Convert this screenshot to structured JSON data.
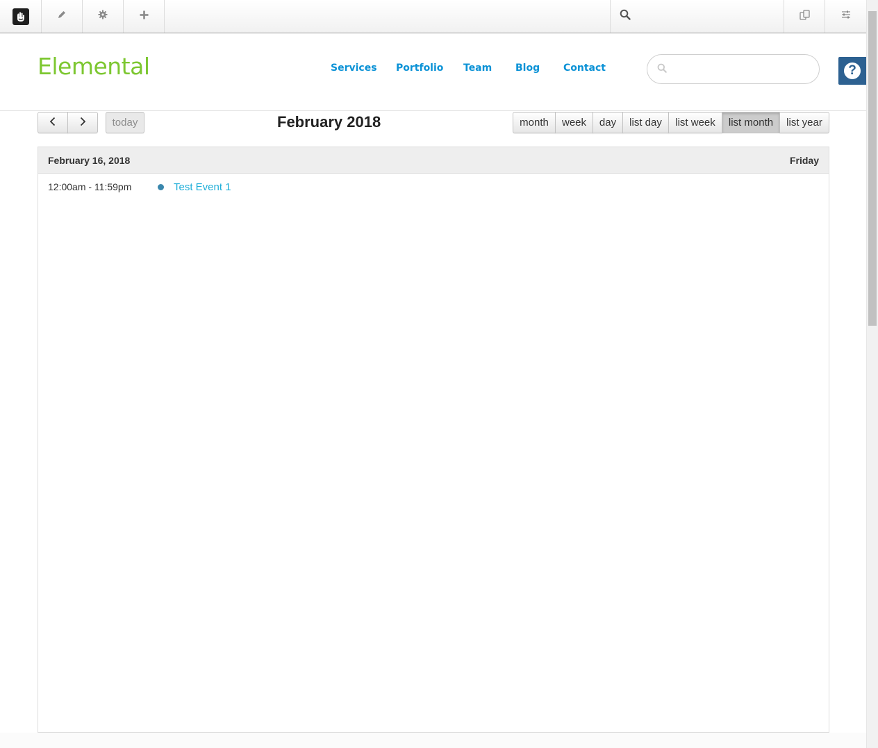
{
  "toolbar": {
    "search_placeholder": "",
    "icons": [
      "concrete5-logo-icon",
      "pencil-icon",
      "gear-icon",
      "plus-icon",
      "search-icon",
      "intelligent-search-icon",
      "sliders-icon"
    ]
  },
  "site": {
    "brand": "Elemental",
    "nav": [
      "Services",
      "Portfolio",
      "Team",
      "Blog",
      "Contact"
    ],
    "search_placeholder": "",
    "help_label": "?",
    "colors": {
      "brand": "#7dc731",
      "nav": "#0b92d6",
      "help": "#2d6191"
    }
  },
  "calendar": {
    "title": "February 2018",
    "today_label": "today",
    "views": [
      "month",
      "week",
      "day",
      "list day",
      "list week",
      "list month",
      "list year"
    ],
    "active_view": "list month",
    "list": [
      {
        "date": "February 16, 2018",
        "weekday": "Friday",
        "events": [
          {
            "time": "12:00am - 11:59pm",
            "title": "Test Event 1",
            "dot_color": "#3a87ad",
            "title_color": "#1eaed8"
          }
        ]
      }
    ]
  }
}
